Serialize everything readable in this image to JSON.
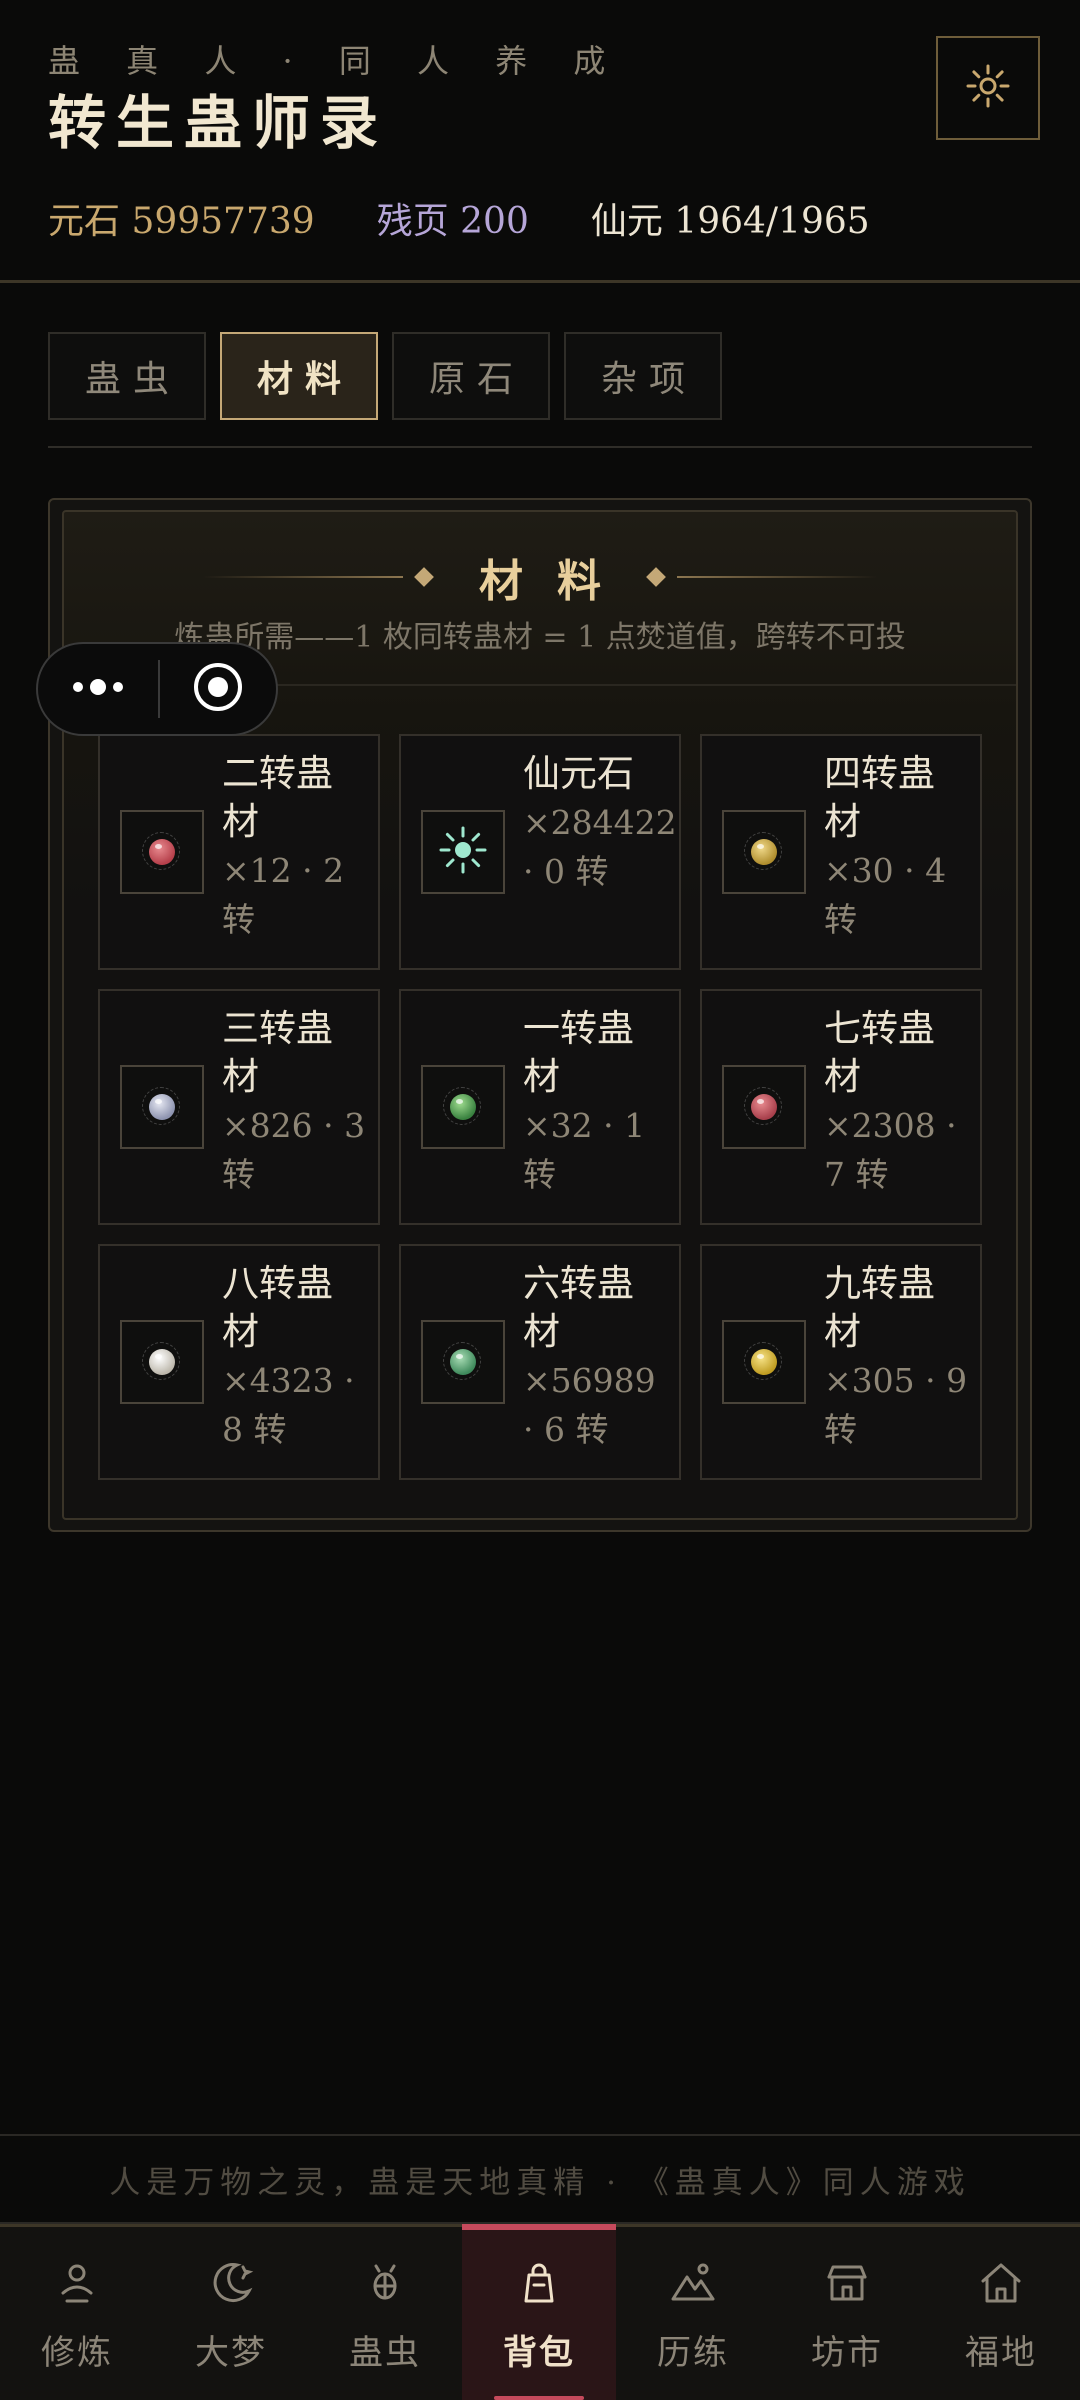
{
  "header": {
    "subtitle": "蛊 真 人 · 同 人 养 成",
    "title": "转生蛊师录",
    "settings_icon": "sun-gear-icon"
  },
  "stats": {
    "yuanshi": "元石 59957739",
    "canye": "残页 200",
    "xianyuan": "仙元 1964/1965"
  },
  "tabs": [
    {
      "label": "蛊虫",
      "active": false
    },
    {
      "label": "材料",
      "active": true
    },
    {
      "label": "原石",
      "active": false
    },
    {
      "label": "杂项",
      "active": false
    }
  ],
  "panel": {
    "title": "材料",
    "description": "炼蛊所需——1 枚同转蛊材 = 1 点焚道值，跨转不可投"
  },
  "items": [
    {
      "name": "二转蛊材",
      "qty": "×12 · 2 转",
      "icon": "red-orb-icon",
      "color": "#c4525c"
    },
    {
      "name": "仙元石",
      "qty": "×284422 · 0 转",
      "icon": "spark-icon",
      "color": "#9fe8cf"
    },
    {
      "name": "四转蛊材",
      "qty": "×30 · 4 转",
      "icon": "gold-orb-icon",
      "color": "#c9a945"
    },
    {
      "name": "三转蛊材",
      "qty": "×826 · 3 转",
      "icon": "silver-orb-icon",
      "color": "#aeb4cc"
    },
    {
      "name": "一转蛊材",
      "qty": "×32 · 1 转",
      "icon": "green-orb-icon",
      "color": "#4f9a54"
    },
    {
      "name": "七转蛊材",
      "qty": "×2308 · 7 转",
      "icon": "red-orb-icon",
      "color": "#c4525c"
    },
    {
      "name": "八转蛊材",
      "qty": "×4323 · 8 转",
      "icon": "white-orb-icon",
      "color": "#d8d4c8"
    },
    {
      "name": "六转蛊材",
      "qty": "×56989 · 6 转",
      "icon": "green-orb-icon",
      "color": "#5a9f74"
    },
    {
      "name": "九转蛊材",
      "qty": "×305 · 9 转",
      "icon": "gold-orb-icon",
      "color": "#d4b33c"
    }
  ],
  "mini_program": {
    "more_icon": "more-dots-icon",
    "close_icon": "target-circle-icon"
  },
  "footer_quote": "人是万物之灵，蛊是天地真精 · 《蛊真人》同人游戏",
  "nav": [
    {
      "label": "修炼",
      "icon": "person-icon",
      "active": false
    },
    {
      "label": "大梦",
      "icon": "moon-icon",
      "active": false
    },
    {
      "label": "蛊虫",
      "icon": "bug-icon",
      "active": false
    },
    {
      "label": "背包",
      "icon": "bag-icon",
      "active": true
    },
    {
      "label": "历练",
      "icon": "mountain-icon",
      "active": false
    },
    {
      "label": "坊市",
      "icon": "shop-icon",
      "active": false
    },
    {
      "label": "福地",
      "icon": "home-icon",
      "active": false
    }
  ]
}
